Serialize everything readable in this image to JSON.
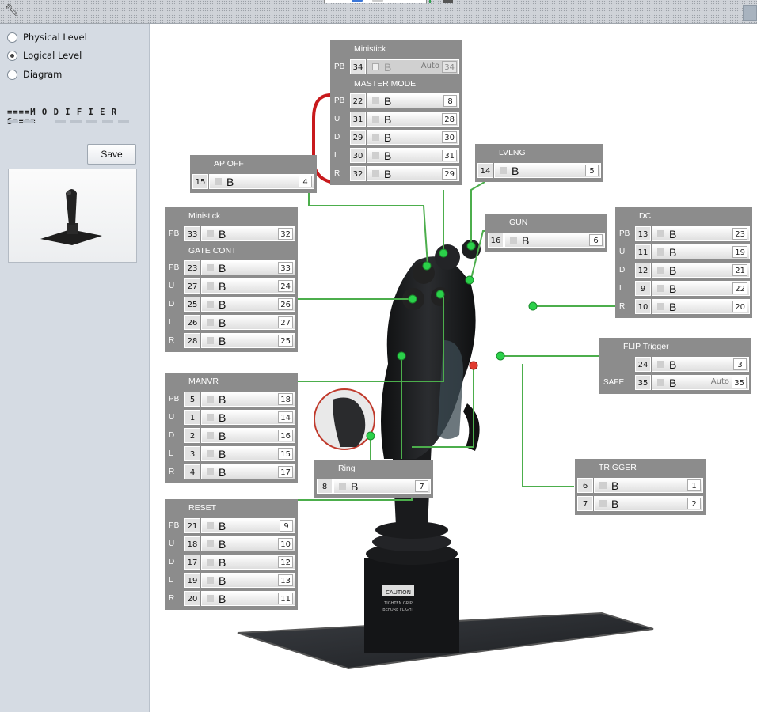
{
  "sidebar": {
    "views": [
      {
        "label": "Physical Level",
        "checked": false
      },
      {
        "label": "Logical Level",
        "checked": true
      },
      {
        "label": "Diagram",
        "checked": false
      }
    ],
    "modifiers_label": "====M O D I F I E R S====",
    "save_label": "Save"
  },
  "icons": {
    "app": "wrench-icon"
  },
  "colors": {
    "panel": "#8c8c8c",
    "link": "#4cae4c",
    "button_dot": "#2bd14a",
    "modifier_link": "#c8191c"
  },
  "panels": {
    "ministick_top": {
      "title": "Ministick",
      "rows": [
        {
          "lbl": "PB",
          "num": "34",
          "btn": "B",
          "out": "34",
          "auto": "Auto"
        }
      ]
    },
    "master_mode": {
      "title": "MASTER MODE",
      "rows": [
        {
          "lbl": "PB",
          "num": "22",
          "btn": "B",
          "out": "8"
        },
        {
          "lbl": "U",
          "num": "31",
          "btn": "B",
          "out": "28"
        },
        {
          "lbl": "D",
          "num": "29",
          "btn": "B",
          "out": "30"
        },
        {
          "lbl": "L",
          "num": "30",
          "btn": "B",
          "out": "31"
        },
        {
          "lbl": "R",
          "num": "32",
          "btn": "B",
          "out": "29"
        }
      ]
    },
    "ap_off": {
      "title": "AP OFF",
      "rows": [
        {
          "lbl": "",
          "num": "15",
          "btn": "B",
          "out": "4"
        }
      ]
    },
    "lvlng": {
      "title": "LVLNG",
      "rows": [
        {
          "lbl": "",
          "num": "14",
          "btn": "B",
          "out": "5"
        }
      ]
    },
    "gun": {
      "title": "GUN",
      "rows": [
        {
          "lbl": "",
          "num": "16",
          "btn": "B",
          "out": "6"
        }
      ]
    },
    "ministick_left": {
      "title": "Ministick",
      "rows": [
        {
          "lbl": "PB",
          "num": "33",
          "btn": "B",
          "out": "32"
        }
      ]
    },
    "gate_cont": {
      "title": "GATE CONT",
      "rows": [
        {
          "lbl": "PB",
          "num": "23",
          "btn": "B",
          "out": "33"
        },
        {
          "lbl": "U",
          "num": "27",
          "btn": "B",
          "out": "24"
        },
        {
          "lbl": "D",
          "num": "25",
          "btn": "B",
          "out": "26"
        },
        {
          "lbl": "L",
          "num": "26",
          "btn": "B",
          "out": "27"
        },
        {
          "lbl": "R",
          "num": "28",
          "btn": "B",
          "out": "25"
        }
      ]
    },
    "dc": {
      "title": "DC",
      "rows": [
        {
          "lbl": "PB",
          "num": "13",
          "btn": "B",
          "out": "23"
        },
        {
          "lbl": "U",
          "num": "11",
          "btn": "B",
          "out": "19"
        },
        {
          "lbl": "D",
          "num": "12",
          "btn": "B",
          "out": "21"
        },
        {
          "lbl": "L",
          "num": "9",
          "btn": "B",
          "out": "22"
        },
        {
          "lbl": "R",
          "num": "10",
          "btn": "B",
          "out": "20"
        }
      ]
    },
    "flip_trigger": {
      "title": "FLIP Trigger",
      "rows": [
        {
          "lbl": "",
          "num": "24",
          "btn": "B",
          "out": "3"
        },
        {
          "lbl": "SAFE",
          "num": "35",
          "btn": "B",
          "out": "35",
          "auto": "Auto"
        }
      ]
    },
    "manvr": {
      "title": "MANVR",
      "rows": [
        {
          "lbl": "PB",
          "num": "5",
          "btn": "B",
          "out": "18"
        },
        {
          "lbl": "U",
          "num": "1",
          "btn": "B",
          "out": "14"
        },
        {
          "lbl": "D",
          "num": "2",
          "btn": "B",
          "out": "16"
        },
        {
          "lbl": "L",
          "num": "3",
          "btn": "B",
          "out": "15"
        },
        {
          "lbl": "R",
          "num": "4",
          "btn": "B",
          "out": "17"
        }
      ]
    },
    "ring": {
      "title": "Ring",
      "rows": [
        {
          "lbl": "",
          "num": "8",
          "btn": "B",
          "out": "7"
        }
      ]
    },
    "trigger": {
      "title": "TRIGGER",
      "rows": [
        {
          "lbl": "",
          "num": "6",
          "btn": "B",
          "out": "1"
        },
        {
          "lbl": "",
          "num": "7",
          "btn": "B",
          "out": "2"
        }
      ]
    },
    "reset": {
      "title": "RESET",
      "rows": [
        {
          "lbl": "PB",
          "num": "21",
          "btn": "B",
          "out": "9"
        },
        {
          "lbl": "U",
          "num": "18",
          "btn": "B",
          "out": "10"
        },
        {
          "lbl": "D",
          "num": "17",
          "btn": "B",
          "out": "12"
        },
        {
          "lbl": "L",
          "num": "19",
          "btn": "B",
          "out": "13"
        },
        {
          "lbl": "R",
          "num": "20",
          "btn": "B",
          "out": "11"
        }
      ]
    }
  },
  "base_plate": {
    "caution": "CAUTION",
    "caution_text_1": "TIGHTEN GRIP",
    "caution_text_2": "BEFORE FLIGHT"
  }
}
